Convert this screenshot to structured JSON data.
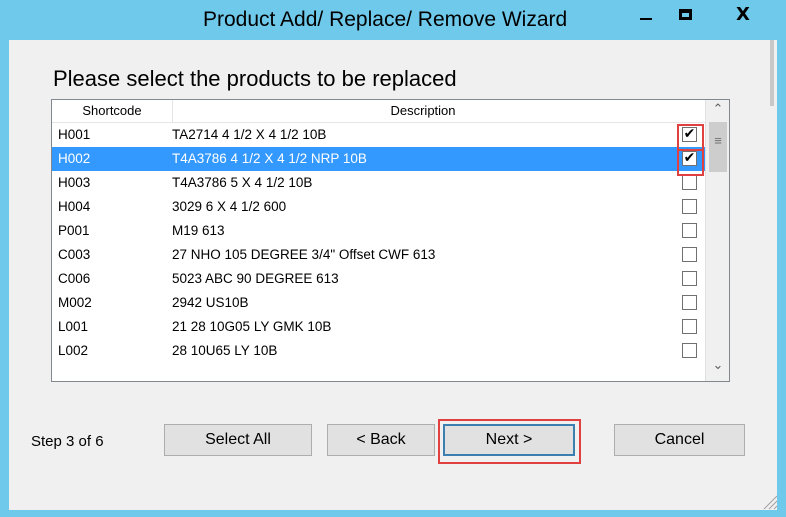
{
  "window": {
    "title": "Product Add/ Replace/ Remove Wizard",
    "controls": {
      "minimize": "—",
      "maximize": "□",
      "close": "X"
    }
  },
  "page": {
    "heading": "Please select the products to be replaced",
    "columns": {
      "shortcode": "Shortcode",
      "description": "Description"
    },
    "rows": [
      {
        "shortcode": "H001",
        "description": "TA2714 4 1/2 X 4 1/2 10B",
        "checked": true,
        "selected": false
      },
      {
        "shortcode": "H002",
        "description": "T4A3786 4 1/2 X 4 1/2 NRP 10B",
        "checked": true,
        "selected": true
      },
      {
        "shortcode": "H003",
        "description": "T4A3786 5 X 4 1/2 10B",
        "checked": false,
        "selected": false
      },
      {
        "shortcode": "H004",
        "description": "3029 6 X 4 1/2 600",
        "checked": false,
        "selected": false
      },
      {
        "shortcode": "P001",
        "description": "M19 613",
        "checked": false,
        "selected": false
      },
      {
        "shortcode": "C003",
        "description": "27 NHO 105 DEGREE 3/4\" Offset CWF 613",
        "checked": false,
        "selected": false
      },
      {
        "shortcode": "C006",
        "description": "5023 ABC 90 DEGREE 613",
        "checked": false,
        "selected": false
      },
      {
        "shortcode": "M002",
        "description": "2942 US10B",
        "checked": false,
        "selected": false
      },
      {
        "shortcode": "L001",
        "description": "21 28 10G05 LY GMK 10B",
        "checked": false,
        "selected": false
      },
      {
        "shortcode": "L002",
        "description": "28 10U65 LY 10B",
        "checked": false,
        "selected": false
      }
    ],
    "check_glyph": "✔",
    "scroll": {
      "up": "ˆ",
      "down": "ˇ",
      "grip": "≡"
    }
  },
  "footer": {
    "step": "Step 3 of 6",
    "select_all": "Select All",
    "back": "< Back",
    "next": "Next >",
    "cancel": "Cancel"
  },
  "colors": {
    "titlebar": "#6fc9ea",
    "selection": "#3399ff",
    "highlight": "#e04040"
  }
}
